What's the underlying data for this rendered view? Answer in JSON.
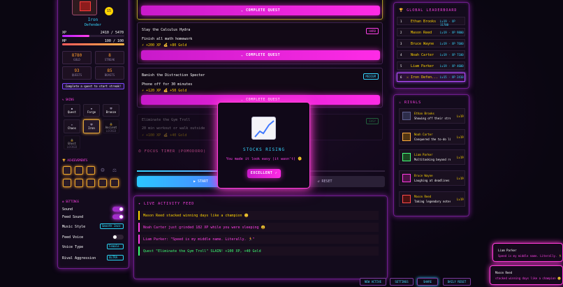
{
  "profile": {
    "level": "15",
    "name": "Iron",
    "title": "Defender",
    "xp_label": "XP",
    "xp_value": "2410 / 5470",
    "xp_fill": 0.44,
    "hp_label": "HP",
    "hp_value": "100 / 100",
    "hp_fill": 1.0,
    "gold": "8780",
    "gold_label": "GOLD",
    "streak": "8",
    "streak_label": "STREAK",
    "quests": "93",
    "quests_label": "QUESTS",
    "boasts": "85",
    "boasts_label": "BOASTS",
    "quest_hint": "Complete a quest to start streak!"
  },
  "skins": {
    "title": "SKINS",
    "items": [
      {
        "name": "Quest",
        "sub": ""
      },
      {
        "name": "Forge",
        "sub": ""
      },
      {
        "name": "Bronze",
        "sub": ""
      },
      {
        "name": "Chaos",
        "sub": ""
      },
      {
        "name": "Iron",
        "sub": ""
      },
      {
        "name": "Ancient",
        "sub": "LOCKED"
      },
      {
        "name": "Ghost",
        "sub": "LOCKED"
      }
    ]
  },
  "achievements": {
    "title": "ACHIEVEMENTS"
  },
  "settings": {
    "title": "SETTINGS",
    "sound": "Sound",
    "feed_sound": "Feed Sound",
    "music_style": "Music Style",
    "music_value": "Smooth Jazz",
    "feed_voice": "Feed Voice",
    "voice_type": "Voice Type",
    "voice_value": "Female",
    "rival_aggression": "Rival Aggression",
    "rival_value": "ULTRA"
  },
  "quests": {
    "complete_label": "COMPLETE QUEST",
    "items": [
      {
        "title": "Slay the Calculus Hydra",
        "tag": "HARD",
        "desc": "Finish all math homework",
        "xp": "+200 XP",
        "gold": "+80 Gold"
      },
      {
        "title": "Banish the Distraction Specter",
        "tag": "MEDIUM",
        "desc": "Phone off for 30 minutes",
        "xp": "+120 XP",
        "gold": "+50 Gold"
      },
      {
        "title": "Eliminate the Gym Troll",
        "tag": "EASY",
        "desc": "20 min workout or walk outside",
        "xp": "+100 XP",
        "gold": "+40 Gold"
      }
    ]
  },
  "focus": {
    "title": "FOCUS TIMER (POMODORO)",
    "start": "START",
    "reset": "RESET"
  },
  "modal": {
    "title": "STOCKS RISING",
    "message": "You made it look easy (it wasn't) 🫠",
    "button": "EXCELLENT ✓"
  },
  "feed": {
    "title": "LIVE ACTIVITY FEED",
    "items": [
      {
        "text": "Mason Reed stacked winning days like a champion 😊",
        "color": "#ffd400"
      },
      {
        "text": "Noah Carter just grinded 182 XP while you were sleeping 😩",
        "color": "#ff40e8"
      },
      {
        "text": "Liam Parker: \"Speed is my middle name. Literally. 🏃\"",
        "color": "#ff40e8"
      },
      {
        "text": "Quest \"Eliminate the Gym Troll\" SLAIN! +100 XP, +40 Gold",
        "color": "#3aff74"
      }
    ]
  },
  "leaderboard": {
    "title": "GLOBAL LEADERBOARD",
    "rows": [
      {
        "rank": "1",
        "name": "Ethan Brooks",
        "stats": "Lv19 · XP 11700"
      },
      {
        "rank": "2",
        "name": "Mason Reed",
        "stats": "Lv19 · XP 9800"
      },
      {
        "rank": "3",
        "name": "Bruce Wayne",
        "stats": "Lv19 · XP 7600"
      },
      {
        "rank": "4",
        "name": "Noah Carter",
        "stats": "Lv19 · XP 7100"
      },
      {
        "rank": "5",
        "name": "Liam Parker",
        "stats": "Lv19 · XP 4600"
      },
      {
        "rank": "6",
        "name": "⚔ Iron Defen...",
        "stats": "Lv15 · XP 2410"
      }
    ]
  },
  "rivals": {
    "title": "RIVALS",
    "items": [
      {
        "name": "Ethan Brooks",
        "quote": "Showing off their streak · XP...",
        "level": "Lv19"
      },
      {
        "name": "Noah Carter",
        "quote": "Conquered the to-do list yo...",
        "level": "Lv19"
      },
      {
        "name": "Liam Parker",
        "quote": "Multitasking beyond reason...",
        "level": "Lv19"
      },
      {
        "name": "Bruce Wayne",
        "quote": "Laughing at deadlines · XP...",
        "level": "Lv19"
      },
      {
        "name": "Mason Reed",
        "quote": "Taking legendary notes at n...",
        "level": "Lv19"
      }
    ]
  },
  "toasts": [
    {
      "name": "Liam Parker",
      "text": "Speed is my middle name. Literally. 🏃"
    },
    {
      "name": "Mason Reed",
      "text": "stacked winning days like a champion 😊"
    }
  ],
  "bottom": {
    "new_active": "NEW ACTIVE",
    "settings": "SETTINGS",
    "share": "SHARE",
    "daily_reset": "DAILY RESET"
  }
}
